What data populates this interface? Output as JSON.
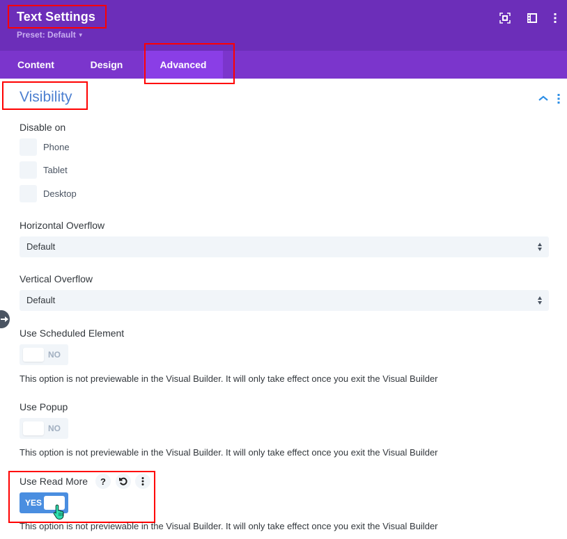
{
  "header": {
    "title": "Text Settings",
    "preset_label": "Preset: Default",
    "icons": [
      "focus-mode-icon",
      "sidebar-layout-icon",
      "more-vertical-icon"
    ]
  },
  "tabs": [
    {
      "label": "Content",
      "active": false
    },
    {
      "label": "Design",
      "active": false
    },
    {
      "label": "Advanced",
      "active": true
    }
  ],
  "section": {
    "title": "Visibility",
    "collapse_icon": "chevron-up-icon",
    "menu_icon": "more-vertical-icon"
  },
  "disable_on": {
    "label": "Disable on",
    "options": [
      {
        "label": "Phone",
        "checked": false
      },
      {
        "label": "Tablet",
        "checked": false
      },
      {
        "label": "Desktop",
        "checked": false
      }
    ]
  },
  "horizontal_overflow": {
    "label": "Horizontal Overflow",
    "value": "Default"
  },
  "vertical_overflow": {
    "label": "Vertical Overflow",
    "value": "Default"
  },
  "scheduled_element": {
    "label": "Use Scheduled Element",
    "toggle": "NO",
    "note": "This option is not previewable in the Visual Builder. It will only take effect once you exit the Visual Builder"
  },
  "popup": {
    "label": "Use Popup",
    "toggle": "NO",
    "note": "This option is not previewable in the Visual Builder. It will only take effect once you exit the Visual Builder"
  },
  "read_more": {
    "label": "Use Read More",
    "help_icon_text": "?",
    "toggle": "YES",
    "note": "This option is not previewable in the Visual Builder. It will only take effect once you exit the Visual Builder"
  },
  "colors": {
    "header_bg": "#6c2eb9",
    "tabs_bg": "#7b35cc",
    "active_tab_bg": "#8a3ee6",
    "section_title": "#4c7fd0",
    "toggle_on": "#4a8ee0",
    "annotation_red": "#ff0000"
  }
}
